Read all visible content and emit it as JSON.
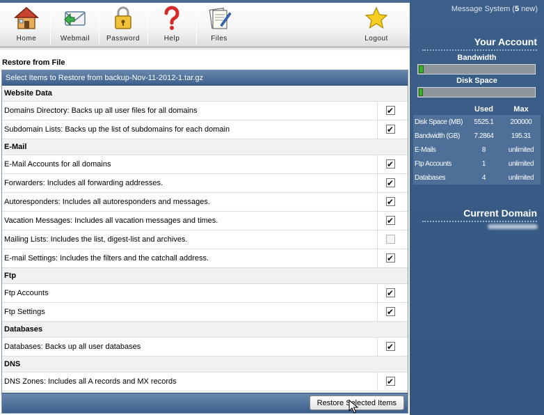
{
  "toolbar": {
    "items": [
      {
        "label": "Home",
        "icon": "home-icon"
      },
      {
        "label": "Webmail",
        "icon": "webmail-icon"
      },
      {
        "label": "Password",
        "icon": "padlock-icon"
      },
      {
        "label": "Help",
        "icon": "question-mark-icon"
      },
      {
        "label": "Files",
        "icon": "files-icon"
      }
    ],
    "logout": {
      "label": "Logout",
      "icon": "star-icon"
    }
  },
  "main": {
    "title": "Restore from File",
    "panel_header": "Select Items to Restore from backup-Nov-11-2012-1.tar.gz",
    "sections": [
      {
        "name": "Website Data",
        "items": [
          {
            "label": "Domains Directory: Backs up all user files for all domains",
            "checked": true
          },
          {
            "label": "Subdomain Lists: Backs up the list of subdomains for each domain",
            "checked": true
          }
        ]
      },
      {
        "name": "E-Mail",
        "items": [
          {
            "label": "E-Mail Accounts for all domains",
            "checked": true
          },
          {
            "label": "Forwarders: Includes all forwarding addresses.",
            "checked": true
          },
          {
            "label": "Autoresponders: Includes all autoresponders and messages.",
            "checked": true
          },
          {
            "label": "Vacation Messages: Includes all vacation messages and times.",
            "checked": true
          },
          {
            "label": "Mailing Lists: Includes the list, digest-list and archives.",
            "checked": false
          },
          {
            "label": "E-mail Settings: Includes the filters and the catchall address.",
            "checked": true
          }
        ]
      },
      {
        "name": "Ftp",
        "items": [
          {
            "label": "Ftp Accounts",
            "checked": true
          },
          {
            "label": "Ftp Settings",
            "checked": true
          }
        ]
      },
      {
        "name": "Databases",
        "items": [
          {
            "label": "Databases: Backs up all user databases",
            "checked": true
          }
        ]
      },
      {
        "name": "DNS",
        "items": [
          {
            "label": "DNS Zones: Includes all A records and MX records",
            "checked": true
          }
        ]
      }
    ],
    "restore_button": "Restore Selected Items"
  },
  "sidebar": {
    "message_prefix": "Message System (",
    "message_count": "5",
    "message_suffix": " new)",
    "account_title": "Your Account",
    "bandwidth_label": "Bandwidth",
    "bandwidth_fraction": 0.04,
    "diskspace_label": "Disk Space",
    "diskspace_fraction": 0.03,
    "usage": {
      "headers": [
        "",
        "Used",
        "Max"
      ],
      "rows": [
        [
          "Disk Space (MB)",
          "5525.1",
          "200000"
        ],
        [
          "Bandwidth (GB)",
          "7.2864",
          "195.31"
        ],
        [
          "E-Mails",
          "8",
          "unlimited"
        ],
        [
          "Ftp Accounts",
          "1",
          "unlimited"
        ],
        [
          "Databases",
          "4",
          "unlimited"
        ]
      ]
    },
    "current_domain_title": "Current Domain"
  }
}
